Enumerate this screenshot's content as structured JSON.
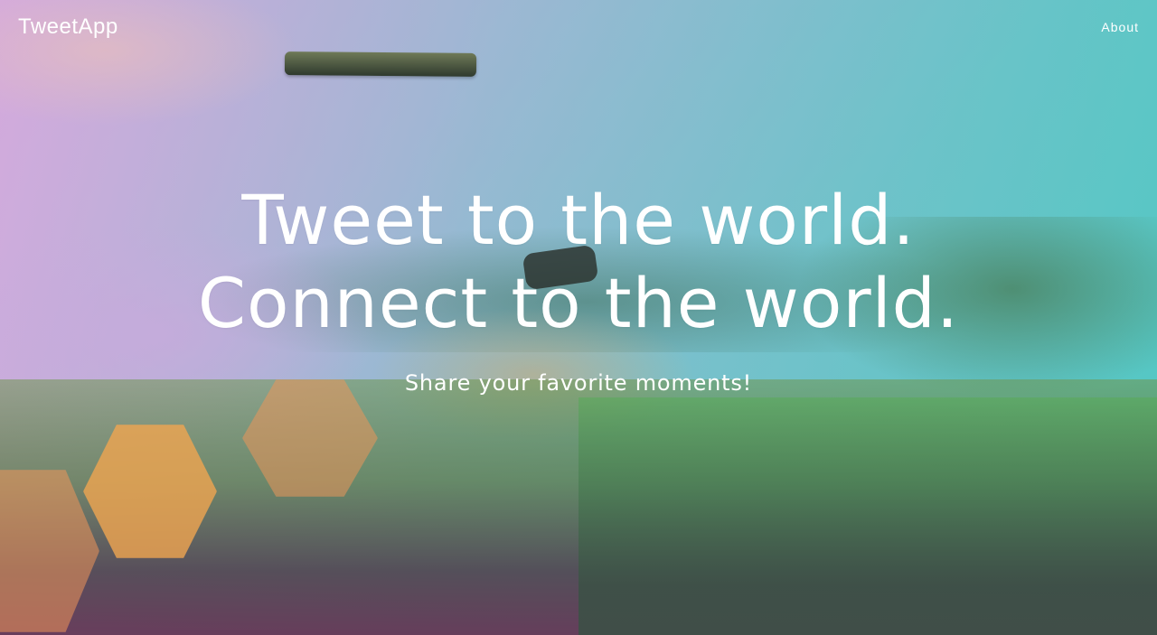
{
  "nav": {
    "logo": "TweetApp",
    "links": [
      {
        "label": "About"
      }
    ]
  },
  "hero": {
    "headline_line1": "Tweet to the world.",
    "headline_line2": "Connect to the world.",
    "subtitle": "Share your favorite moments!"
  },
  "colors": {
    "text": "#ffffff",
    "overlay_left": "#c9a8d6",
    "overlay_right": "#4ec9c2",
    "bokeh": "#f0a550"
  }
}
